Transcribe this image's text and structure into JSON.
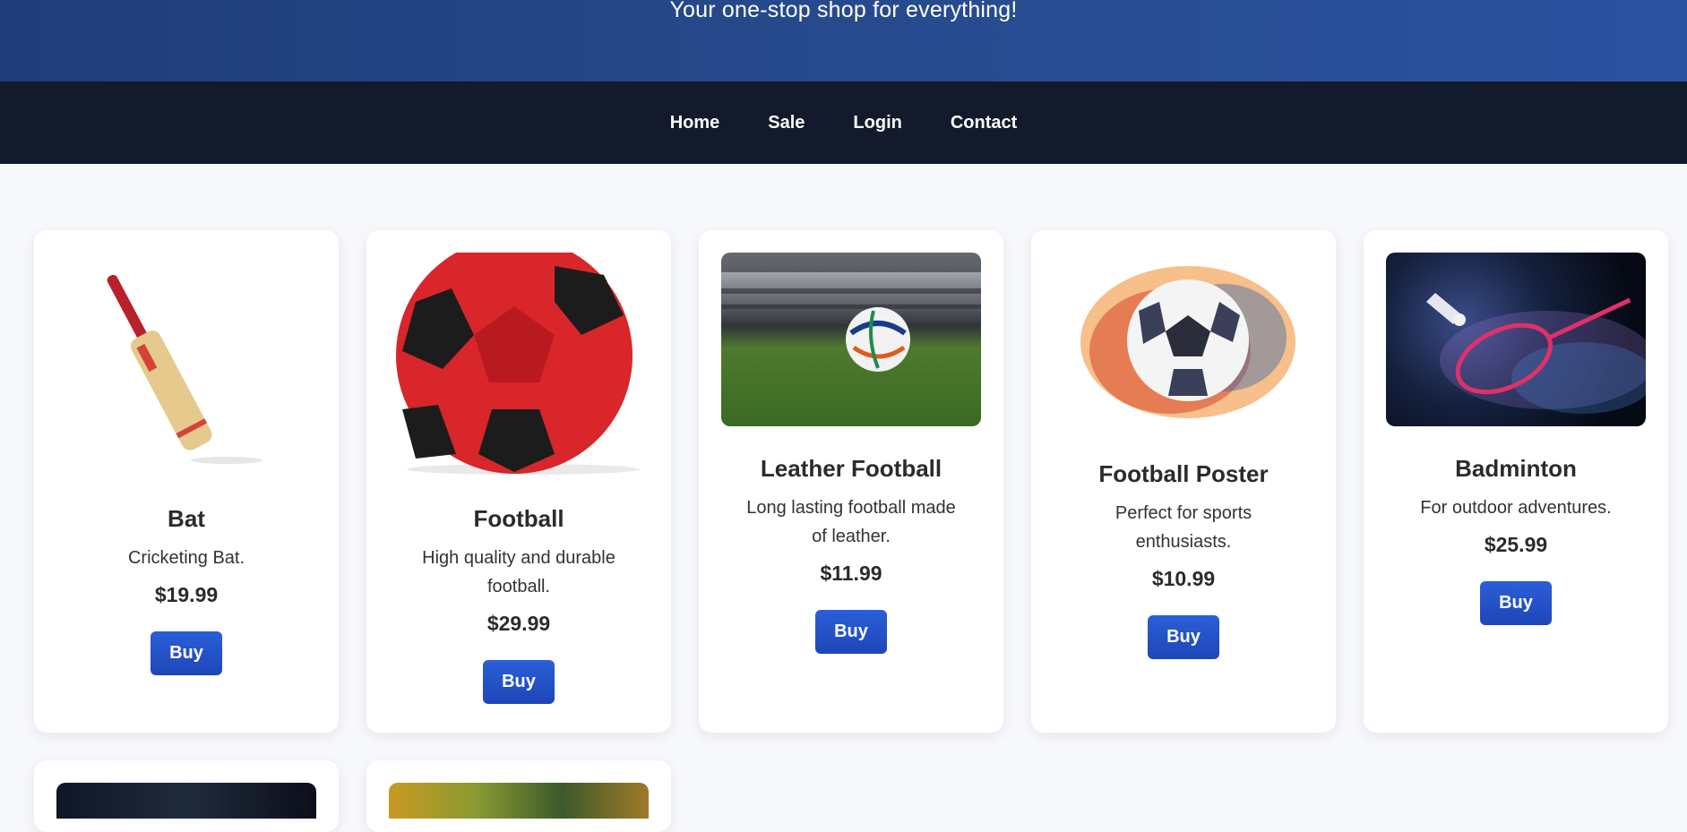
{
  "hero": {
    "tagline": "Your one-stop shop for everything!"
  },
  "nav": {
    "items": [
      "Home",
      "Sale",
      "Login",
      "Contact"
    ]
  },
  "products": [
    {
      "name": "Bat",
      "description": "Cricketing Bat.",
      "price": "$19.99",
      "button": "Buy"
    },
    {
      "name": "Football",
      "description": "High quality and durable football.",
      "price": "$29.99",
      "button": "Buy"
    },
    {
      "name": "Leather Football",
      "description": "Long lasting football made of leather.",
      "price": "$11.99",
      "button": "Buy"
    },
    {
      "name": "Football Poster",
      "description": "Perfect for sports enthusiasts.",
      "price": "$10.99",
      "button": "Buy"
    },
    {
      "name": "Badminton",
      "description": "For outdoor adventures.",
      "price": "$25.99",
      "button": "Buy"
    }
  ],
  "colors": {
    "hero": "#274a8d",
    "nav": "#121a2c",
    "button": "#2a5fd8",
    "page": "#f7f8fb"
  }
}
